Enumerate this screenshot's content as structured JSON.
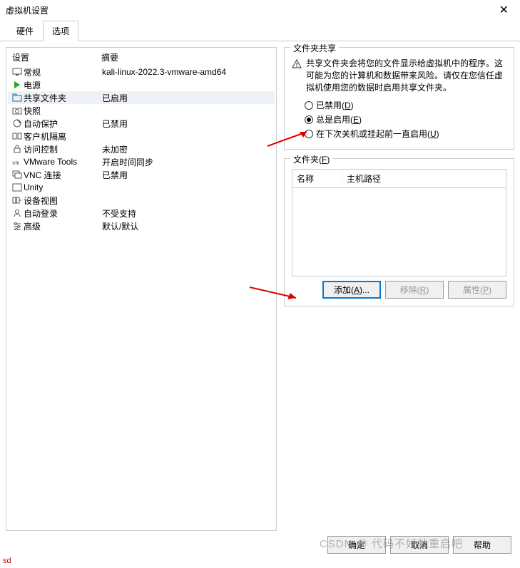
{
  "window": {
    "title": "虚拟机设置"
  },
  "tabs": {
    "hardware": "硬件",
    "options": "选项"
  },
  "list_header": {
    "col_name": "设置",
    "col_summary": "摘要"
  },
  "settings": [
    {
      "name": "常规",
      "summary": "kali-linux-2022.3-vmware-amd64",
      "icon": "monitor"
    },
    {
      "name": "电源",
      "summary": "",
      "icon": "power"
    },
    {
      "name": "共享文件夹",
      "summary": "已启用",
      "icon": "shared-folder",
      "selected": true
    },
    {
      "name": "快照",
      "summary": "",
      "icon": "snapshot"
    },
    {
      "name": "自动保护",
      "summary": "已禁用",
      "icon": "autoprotect"
    },
    {
      "name": "客户机隔离",
      "summary": "",
      "icon": "isolation"
    },
    {
      "name": "访问控制",
      "summary": "未加密",
      "icon": "access"
    },
    {
      "name": "VMware Tools",
      "summary": "开启时间同步",
      "icon": "vmtools"
    },
    {
      "name": "VNC 连接",
      "summary": "已禁用",
      "icon": "vnc"
    },
    {
      "name": "Unity",
      "summary": "",
      "icon": "unity"
    },
    {
      "name": "设备视图",
      "summary": "",
      "icon": "appliance"
    },
    {
      "name": "自动登录",
      "summary": "不受支持",
      "icon": "autologin"
    },
    {
      "name": "高级",
      "summary": "默认/默认",
      "icon": "advanced"
    }
  ],
  "sharing": {
    "group_title": "文件夹共享",
    "warning": "共享文件夹会将您的文件显示给虚拟机中的程序。这可能为您的计算机和数据带来风险。请仅在您信任虚拟机使用您的数据时启用共享文件夹。",
    "radio_disabled_pre": "已禁用(",
    "radio_disabled_u": "D",
    "radio_disabled_post": ")",
    "radio_always_pre": "总是启用(",
    "radio_always_u": "E",
    "radio_always_post": ")",
    "radio_untilnext_pre": "在下次关机或挂起前一直启用(",
    "radio_untilnext_u": "U",
    "radio_untilnext_post": ")"
  },
  "folders": {
    "group_title_pre": "文件夹(",
    "group_title_u": "F",
    "group_title_post": ")",
    "col_name": "名称",
    "col_path": "主机路径",
    "add_pre": "添加(",
    "add_u": "A",
    "add_post": ")...",
    "remove_pre": "移除(",
    "remove_u": "R",
    "remove_post": ")",
    "props_pre": "属性(",
    "props_u": "P",
    "props_post": ")"
  },
  "bottom": {
    "ok": "确定",
    "cancel": "取消",
    "help": "帮助"
  },
  "watermark": "CSDN @ 代码不好就重启吧",
  "sd": "sd"
}
